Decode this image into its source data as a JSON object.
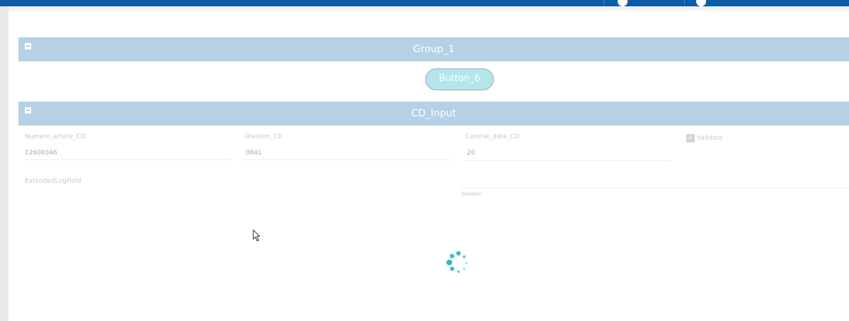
{
  "top_bar": {
    "brand_color": "#0d5ca8",
    "icons": [
      "user-icon",
      "user-icon"
    ]
  },
  "groups": {
    "group1": {
      "title": "Group_1"
    },
    "cd_input": {
      "title": "CD_Input"
    }
  },
  "button6": {
    "label": "Button_6"
  },
  "fields": {
    "numero_article": {
      "label": "Numero_article_CD",
      "value": "12600346"
    },
    "division": {
      "label": "Division_CD",
      "value": "0841"
    },
    "contrat_date": {
      "label": "Contrat_date_CD",
      "value": "20"
    },
    "validate": {
      "label": "Validate",
      "checked": true
    },
    "extended_log": {
      "label": "ExtendedLogField"
    },
    "sublabel": {
      "text": "Sublabel"
    }
  },
  "loading": {
    "accent": "#3bbfc9"
  }
}
